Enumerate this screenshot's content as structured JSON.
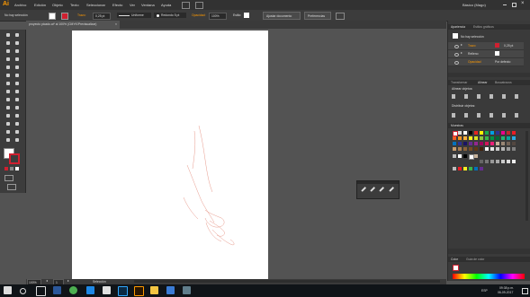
{
  "app": {
    "logo": "Ai"
  },
  "menu": [
    "Archivo",
    "Edición",
    "Objeto",
    "Texto",
    "Seleccionar",
    "Efecto",
    "Ver",
    "Ventana",
    "Ayuda"
  ],
  "workspace": "Básico (Mago)",
  "control": {
    "selection": "No hay selección",
    "stroke_label": "Trazo:",
    "stroke_value": "0,25 pt",
    "profile": "Uniforme",
    "brush": "Redondo 5 pt",
    "opacity_label": "Opacidad:",
    "opacity_value": "100%",
    "style_label": "Estilo:",
    "doc_setup": "Ajustar documento",
    "preferences": "Preferencias"
  },
  "document_tab": "proyecto picado.ai* al 100% (CMYK/Previsualizar)",
  "appearance": {
    "tabs": [
      "Apariencia",
      "Estilos gráficos"
    ],
    "heading": "No hay selección",
    "rows": [
      {
        "label": "Trazo",
        "value": "0,25 pt"
      },
      {
        "label": "Relleno",
        "value": ""
      },
      {
        "label": "Opacidad",
        "value": "Por defecto"
      }
    ]
  },
  "align": {
    "tabs": [
      "Transformar",
      "Alinear",
      "Buscatrazos"
    ],
    "align_objects": "Alinear objetos:",
    "distribute_objects": "Distribuir objetos:"
  },
  "swatches": {
    "tab": "Muestras"
  },
  "color_panel": {
    "tabs": [
      "Color",
      "Guía de color"
    ]
  },
  "status": {
    "zoom": "100%",
    "page": "1",
    "tool": "Selección"
  },
  "taskbar": {
    "lang": "ESP",
    "time": "09:38 p.m.",
    "date": "06-09-2017"
  },
  "colors": {
    "accent": "#ff9a00",
    "red": "#d02030"
  }
}
